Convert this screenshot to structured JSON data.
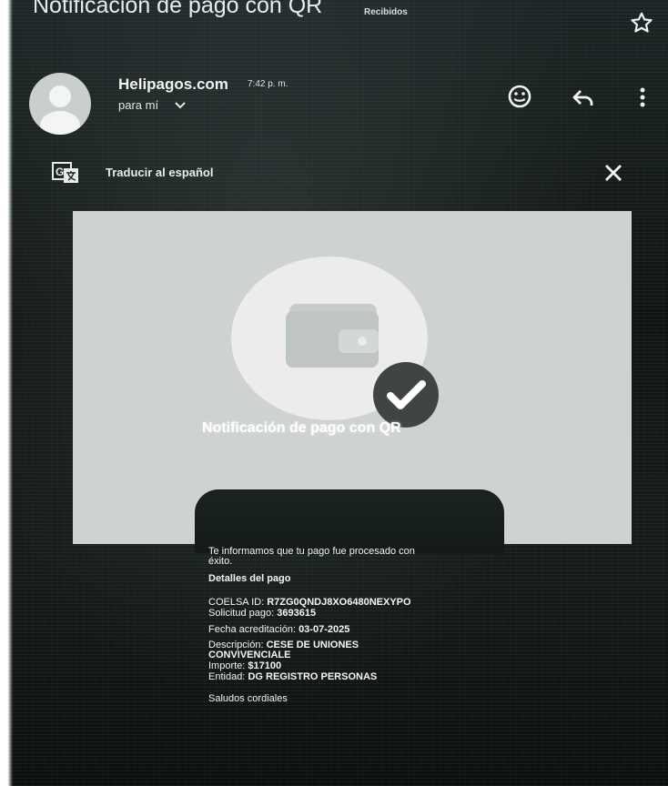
{
  "email": {
    "subject": "Notificación de pago con QR",
    "folder_badge": "Recibidos",
    "sender": "Helipagos.com",
    "time": "7:42 p. m.",
    "recipient": "para mí"
  },
  "translate_bar": {
    "label": "Traducir al español"
  },
  "card": {
    "title": "Notificación de pago con QR"
  },
  "message": {
    "intro_line1": "Te informamos que tu pago fue procesado con",
    "intro_line2": "éxito.",
    "details_heading": "Detalles del pago",
    "coelsa_label": "COELSA ID:",
    "coelsa_value": "R7ZG0QNDJ8XO6480NEXYPO",
    "solicitud_label": "Solicitud pago:",
    "solicitud_value": "3693615",
    "fecha_label": "Fecha acreditación:",
    "fecha_value": "03-07-2025",
    "descripcion_label": "Descripción:",
    "descripcion_value_line1": "CESE DE UNIONES",
    "descripcion_value_line2": "CONVIVENCIALE",
    "importe_label": "Importe:",
    "importe_value": "$17100",
    "entidad_label": "Entidad:",
    "entidad_value": "DG REGISTRO PERSONAS",
    "closing": "Saludos cordiales"
  },
  "icons": {
    "star": "star-icon",
    "avatar": "person-icon",
    "emoji": "emoji-icon",
    "reply": "reply-icon",
    "more": "more-vert-icon",
    "translate": "translate-icon",
    "close": "close-icon",
    "wallet": "wallet-icon",
    "check": "check-badge-icon"
  },
  "colors": {
    "background": "#121818",
    "card": "#cfd2d2",
    "text": "#f2f4f4"
  }
}
